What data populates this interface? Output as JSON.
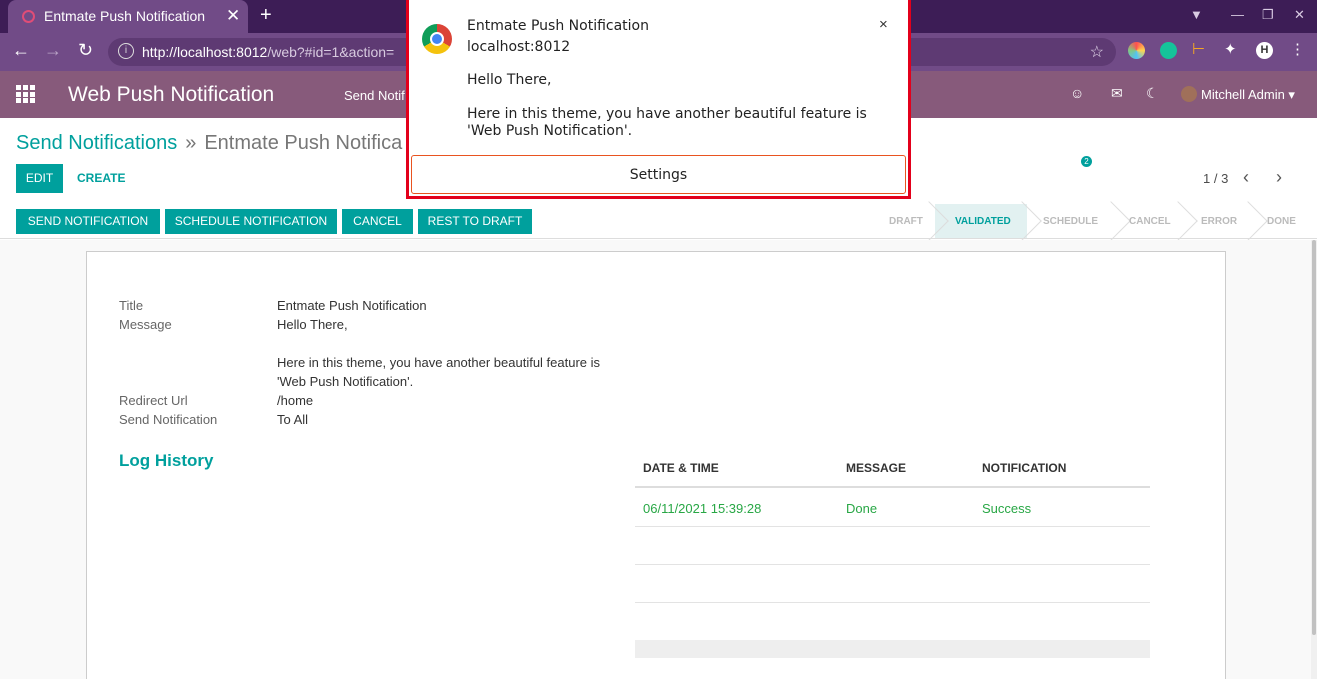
{
  "browser": {
    "tab_title": "Entmate Push Notification",
    "new_tab": "+",
    "close_tab": "✕",
    "url_host": "http://localhost:8012",
    "url_path": "/web?#id=1&action=",
    "ext_h": "H"
  },
  "navbar": {
    "brand": "Web Push Notification",
    "menu_item": "Send Notif",
    "activity_badge": "2",
    "user_name": "Mitchell Admin"
  },
  "breadcrumb": {
    "parent": "Send Notifications",
    "separator": "»",
    "current": "Entmate Push Notifica"
  },
  "buttons": {
    "edit": "EDIT",
    "create": "CREATE",
    "send_notification": "SEND NOTIFICATION",
    "schedule_notification": "SCHEDULE NOTIFICATION",
    "cancel": "CANCEL",
    "reset_to_draft": "REST TO DRAFT"
  },
  "pager": {
    "value": "1 / 3"
  },
  "stages": [
    "DRAFT",
    "VALIDATED",
    "SCHEDULE",
    "CANCEL",
    "ERROR",
    "DONE"
  ],
  "form": {
    "title_label": "Title",
    "title_value": "Entmate Push Notification",
    "message_label": "Message",
    "message_line1": "Hello There,",
    "message_line2": "Here in this theme, you have another beautiful feature is",
    "message_line3": "'Web Push Notification'.",
    "redirect_label": "Redirect Url",
    "redirect_value": "/home",
    "send_label": "Send Notification",
    "send_value": "To All"
  },
  "log_history": {
    "title": "Log History",
    "columns": [
      "DATE & TIME",
      "MESSAGE",
      "NOTIFICATION"
    ],
    "rows": [
      {
        "datetime": "06/11/2021 15:39:28",
        "message": "Done",
        "notification": "Success"
      }
    ]
  },
  "popup": {
    "title": "Entmate Push Notification",
    "origin": "localhost:8012",
    "message1": "Hello There,",
    "message2": "Here in this theme, you have another beautiful feature is 'Web Push Notification'.",
    "settings": "Settings",
    "close": "×"
  },
  "colors": {
    "accent": "#00a09d",
    "navbar": "#875a7b",
    "browser_toolbar": "#714b87",
    "success": "#28a745",
    "highlight_border": "#e3001b"
  }
}
